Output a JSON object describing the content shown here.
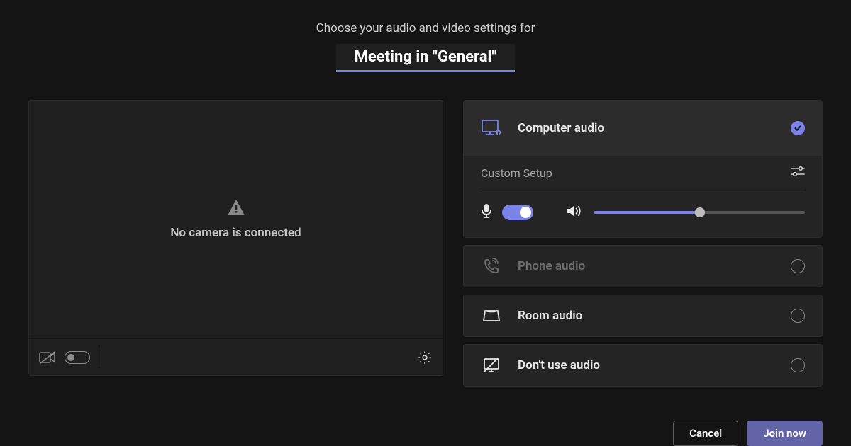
{
  "header": {
    "subtitle": "Choose your audio and video settings for",
    "title": "Meeting in \"General\""
  },
  "preview": {
    "message": "No camera is connected"
  },
  "computer_audio": {
    "label": "Computer audio",
    "selected": true,
    "custom_setup_label": "Custom Setup",
    "mic_on": true,
    "volume_percent": 50
  },
  "phone_audio": {
    "label": "Phone audio",
    "enabled": false
  },
  "room_audio": {
    "label": "Room audio"
  },
  "no_audio": {
    "label": "Don't use audio"
  },
  "footer": {
    "cancel": "Cancel",
    "join": "Join now"
  },
  "colors": {
    "accent": "#6264a7",
    "accent_light": "#7b83eb"
  }
}
